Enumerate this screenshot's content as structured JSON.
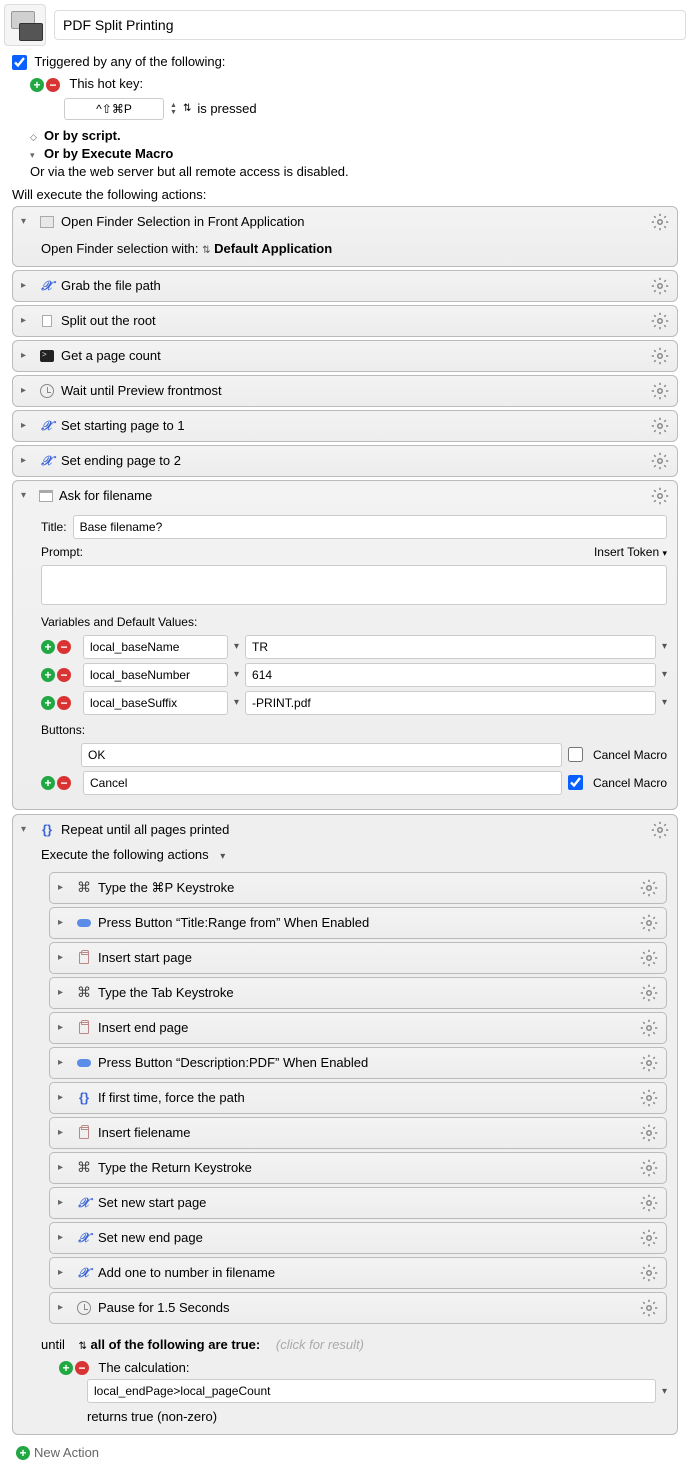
{
  "macro_title": "PDF Split Printing",
  "triggered_label": "Triggered by any of the following:",
  "hotkey_label": "This hot key:",
  "hotkey_value": "^⇧⌘P",
  "hotkey_pressed": "is pressed",
  "or_script": "Or by script.",
  "or_execute": "Or by Execute Macro",
  "or_webserver": "Or via the web server but all remote access is disabled.",
  "will_execute": "Will execute the following actions:",
  "open_finder": {
    "title": "Open Finder Selection in Front Application",
    "body_prefix": "Open Finder selection with:",
    "body_value": "Default Application"
  },
  "actions_top": [
    {
      "icon": "x",
      "label": "Grab the file path"
    },
    {
      "icon": "file",
      "label": "Split out the root"
    },
    {
      "icon": "term",
      "label": "Get a page count"
    },
    {
      "icon": "clock",
      "label": "Wait until Preview frontmost"
    },
    {
      "icon": "x",
      "label": "Set starting page to 1"
    },
    {
      "icon": "x",
      "label": "Set ending page to 2"
    }
  ],
  "ask_filename": {
    "title": "Ask for filename",
    "title_label": "Title:",
    "title_value": "Base filename?",
    "prompt_label": "Prompt:",
    "insert_token": "Insert Token",
    "vars_label": "Variables and Default Values:",
    "vars": [
      {
        "name": "local_baseName",
        "value": "TR"
      },
      {
        "name": "local_baseNumber",
        "value": "614"
      },
      {
        "name": "local_baseSuffix",
        "value": "-PRINT.pdf"
      }
    ],
    "buttons_label": "Buttons:",
    "buttons": [
      {
        "name": "OK",
        "cancel": false
      },
      {
        "name": "Cancel",
        "cancel": true
      }
    ],
    "cancel_macro_label": "Cancel Macro"
  },
  "repeat": {
    "title": "Repeat until all pages printed",
    "execute_label": "Execute the following actions",
    "actions": [
      {
        "icon": "cmd",
        "label": "Type the ⌘P Keystroke"
      },
      {
        "icon": "pill",
        "label": "Press Button “Title:Range from” When Enabled"
      },
      {
        "icon": "clip",
        "label": "Insert start page"
      },
      {
        "icon": "cmd",
        "label": "Type the Tab Keystroke"
      },
      {
        "icon": "clip",
        "label": "Insert end page"
      },
      {
        "icon": "pill",
        "label": "Press Button “Description:PDF” When Enabled"
      },
      {
        "icon": "braces",
        "label": "If first time, force the path"
      },
      {
        "icon": "clip",
        "label": "Insert fielename"
      },
      {
        "icon": "cmd",
        "label": "Type the Return Keystroke"
      },
      {
        "icon": "x",
        "label": "Set new start page"
      },
      {
        "icon": "x",
        "label": "Set new end page"
      },
      {
        "icon": "x",
        "label": "Add one to number in filename"
      },
      {
        "icon": "clock",
        "label": "Pause for 1.5 Seconds"
      }
    ],
    "until_label": "until",
    "all_following": "all of the following are true:",
    "click_result": "(click for result)",
    "calc_label": "The calculation:",
    "calc_value": "local_endPage>local_pageCount",
    "returns": "returns true (non-zero)"
  },
  "new_action": "New Action"
}
